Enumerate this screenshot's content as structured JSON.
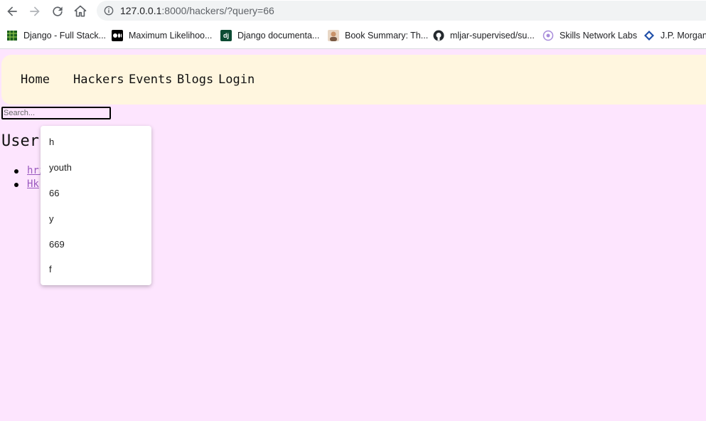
{
  "browser": {
    "url_host": "127.0.0.1",
    "url_path": ":8000/hackers/?query=66"
  },
  "bookmarks": [
    {
      "label": "Django - Full Stack...",
      "icon": "grid-favicon",
      "color": "#2e7d32"
    },
    {
      "label": "Maximum Likelihoo...",
      "icon": "medium-favicon",
      "color": "#000000"
    },
    {
      "label": "Django documenta...",
      "icon": "django-favicon",
      "color": "#0c4b33"
    },
    {
      "label": "Book Summary: Th...",
      "icon": "avatar-favicon",
      "color": "#c9a27e"
    },
    {
      "label": "mljar-supervised/su...",
      "icon": "github-favicon",
      "color": "#24292e"
    },
    {
      "label": "Skills Network Labs",
      "icon": "skills-network-favicon",
      "color": "#a78bda"
    },
    {
      "label": "J.P. Morgan",
      "icon": "jpmorgan-favicon",
      "color": "#1e4ea8"
    }
  ],
  "navbar": {
    "home": "Home",
    "hackers": "Hackers",
    "events": "Events",
    "blogs": "Blogs",
    "login": "Login"
  },
  "search": {
    "placeholder": "Search..."
  },
  "heading": "Users",
  "results": [
    "hri",
    "Hk"
  ],
  "autocomplete": [
    "h",
    "youth",
    "66",
    "y",
    "669",
    "f"
  ],
  "colors": {
    "page_bg": "#fde5fe",
    "navbar_bg": "#fff6df",
    "link": "#9a59bf"
  }
}
